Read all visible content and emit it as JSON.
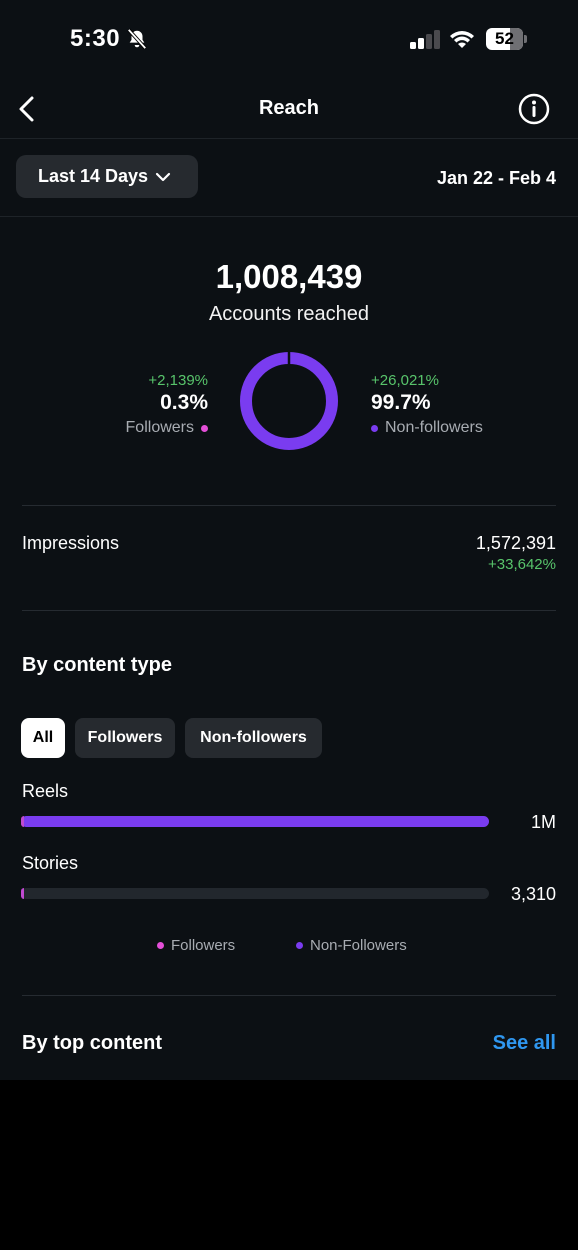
{
  "status_bar": {
    "time": "5:30",
    "battery": "52"
  },
  "header": {
    "title": "Reach"
  },
  "filter": {
    "range_label": "Last 14 Days",
    "date_range": "Jan 22 - Feb 4"
  },
  "reach": {
    "total": "1,008,439",
    "label": "Accounts reached",
    "followers": {
      "change": "+2,139%",
      "percent": "0.3%",
      "label": "Followers",
      "share": 0.003
    },
    "non_followers": {
      "change": "+26,021%",
      "percent": "99.7%",
      "label": "Non-followers",
      "share": 0.997
    }
  },
  "impressions": {
    "label": "Impressions",
    "value": "1,572,391",
    "change": "+33,642%"
  },
  "content_type": {
    "title": "By content type",
    "tabs": [
      "All",
      "Followers",
      "Non-followers"
    ],
    "active_tab": "All",
    "rows": [
      {
        "label": "Reels",
        "value": "1M",
        "fill": 1.0
      },
      {
        "label": "Stories",
        "value": "3,310",
        "fill": 0.003
      }
    ],
    "legend": {
      "followers": "Followers",
      "non_followers": "Non-Followers"
    }
  },
  "top_content": {
    "title": "By top content",
    "see_all": "See all"
  },
  "colors": {
    "followers": "#e44fd8",
    "non_followers": "#7a3cf0",
    "positive": "#58c46b",
    "link": "#2f97f0"
  }
}
